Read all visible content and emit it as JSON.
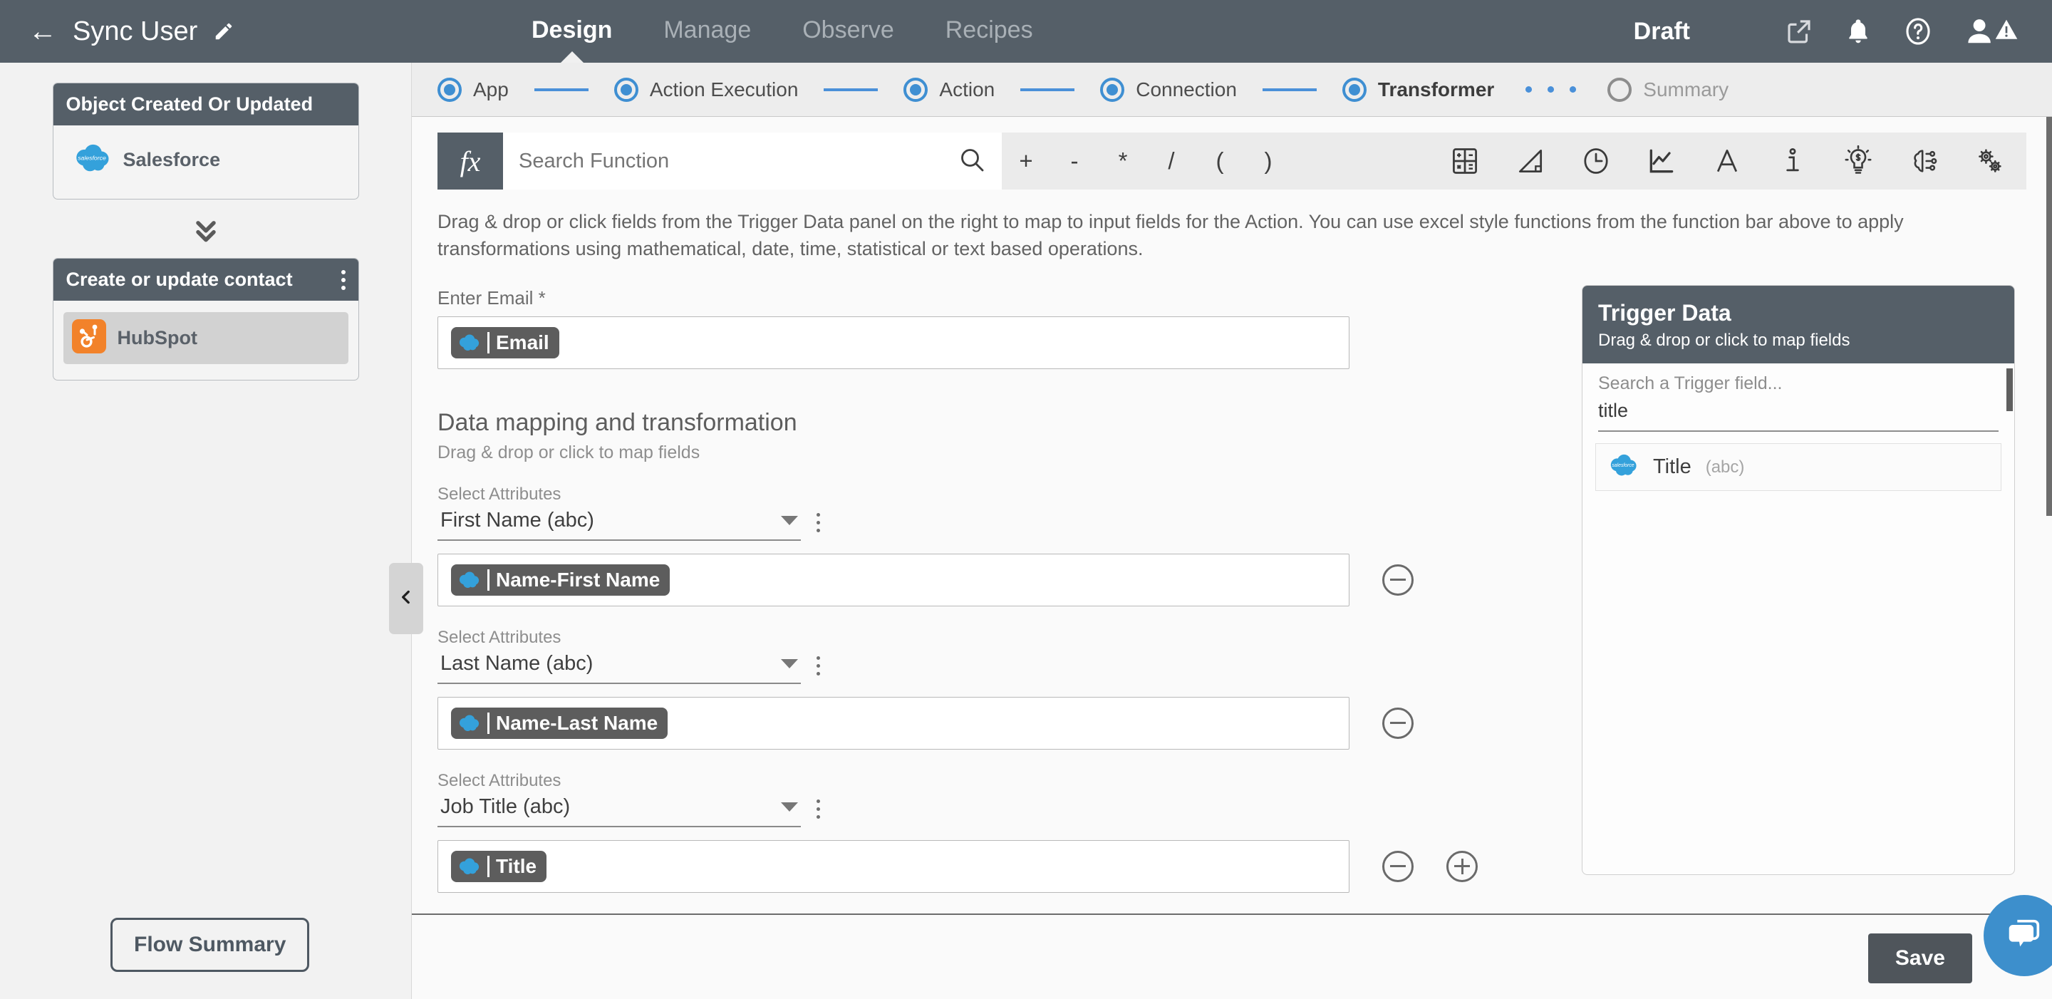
{
  "header": {
    "back_icon": "back-arrow-icon",
    "flow_name": "Sync User",
    "edit_icon": "pencil-icon",
    "nav": [
      {
        "label": "Design",
        "active": true
      },
      {
        "label": "Manage",
        "active": false
      },
      {
        "label": "Observe",
        "active": false
      },
      {
        "label": "Recipes",
        "active": false
      }
    ],
    "status": "Draft",
    "icons": [
      "external-link-icon",
      "bell-icon",
      "help-icon",
      "user-avatar-icon",
      "warning-badge-icon"
    ]
  },
  "sidebar": {
    "trigger_card": {
      "title": "Object Created Or Updated",
      "app": "Salesforce",
      "app_icon": "salesforce-icon"
    },
    "connector_icon": "double-chevron-down-icon",
    "action_card": {
      "title": "Create or update contact",
      "menu_icon": "kebab-menu-icon",
      "app": "HubSpot",
      "app_icon": "hubspot-icon"
    },
    "flow_summary_label": "Flow Summary",
    "collapse_icon": "chevron-left-icon"
  },
  "stepper": {
    "steps": [
      {
        "label": "App",
        "state": "complete"
      },
      {
        "label": "Action Execution",
        "state": "complete"
      },
      {
        "label": "Action",
        "state": "complete"
      },
      {
        "label": "Connection",
        "state": "complete"
      },
      {
        "label": "Transformer",
        "state": "active"
      },
      {
        "label": "Summary",
        "state": "pending"
      }
    ]
  },
  "function_bar": {
    "fx_label": "fx",
    "search_placeholder": "Search Function",
    "search_value": "",
    "search_icon": "search-icon",
    "operators": [
      "+",
      "-",
      "*",
      "/",
      "(",
      ")"
    ],
    "category_icons": [
      "calculator-icon",
      "trigonometry-icon",
      "clock-icon",
      "statistics-chart-icon",
      "text-format-icon",
      "info-icon",
      "lightbulb-icon",
      "ai-brain-icon",
      "utilities-gears-icon"
    ]
  },
  "main": {
    "description": "Drag & drop or click fields from the Trigger Data panel on the right to map to input fields for the Action. You can use excel style functions from the function bar above to apply transformations using mathematical, date, time, statistical or text based operations.",
    "email_field": {
      "label": "Enter Email *",
      "chip": {
        "icon": "salesforce-icon",
        "text": "Email"
      }
    },
    "mapping_section": {
      "title": "Data mapping and transformation",
      "subtitle": "Drag & drop or click to map fields",
      "attribute_label": "Select Attributes",
      "rows": [
        {
          "attribute": "First Name (abc)",
          "chip": {
            "icon": "salesforce-icon",
            "text": "Name-First Name"
          },
          "remove_icon": "minus-circle-icon",
          "add_icon": null
        },
        {
          "attribute": "Last Name (abc)",
          "chip": {
            "icon": "salesforce-icon",
            "text": "Name-Last Name"
          },
          "remove_icon": "minus-circle-icon",
          "add_icon": null
        },
        {
          "attribute": "Job Title (abc)",
          "chip": {
            "icon": "salesforce-icon",
            "text": "Title"
          },
          "remove_icon": "minus-circle-icon",
          "add_icon": "plus-circle-icon"
        }
      ]
    }
  },
  "trigger_panel": {
    "title": "Trigger Data",
    "subtitle": "Drag & drop or click to map fields",
    "search_label": "Search a Trigger field...",
    "search_value": "title",
    "results": [
      {
        "name": "Title",
        "type": "(abc)",
        "icon": "salesforce-icon"
      }
    ]
  },
  "footer": {
    "save_label": "Save",
    "chat_icon": "chat-bubble-icon"
  },
  "colors": {
    "header_bg": "#555f68",
    "accent_blue": "#3f8fd2",
    "chip_bg": "#5d5d5d",
    "salesforce_blue": "#34a1db",
    "hubspot_orange": "#f2822a",
    "chat_blue": "#3d8fcc"
  }
}
